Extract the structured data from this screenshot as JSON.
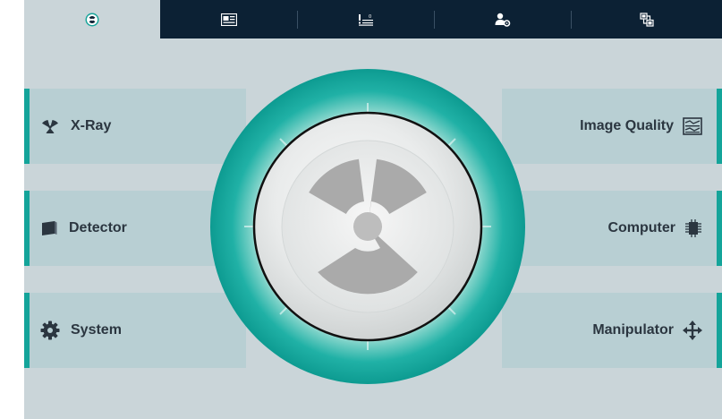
{
  "tabs": [
    {
      "icon": "radiation-icon",
      "active": true
    },
    {
      "icon": "image-gallery-icon",
      "active": false
    },
    {
      "icon": "calibration-icon",
      "active": false
    },
    {
      "icon": "user-settings-icon",
      "active": false
    },
    {
      "icon": "network-icon",
      "active": false
    }
  ],
  "menu": {
    "left": [
      {
        "label": "X-Ray",
        "icon": "radiation-icon"
      },
      {
        "label": "Detector",
        "icon": "detector-icon"
      },
      {
        "label": "System",
        "icon": "gear-icon"
      }
    ],
    "right": [
      {
        "label": "Image Quality",
        "icon": "image-quality-icon"
      },
      {
        "label": "Computer",
        "icon": "chip-icon"
      },
      {
        "label": "Manipulator",
        "icon": "move-arrows-icon"
      }
    ]
  },
  "dial": {
    "icon": "radiation-icon"
  },
  "colors": {
    "accent": "#14a49a",
    "tabbar": "#0c2134",
    "background": "#cad5d9",
    "row": "#b8cfd3",
    "text": "#2b3640"
  }
}
